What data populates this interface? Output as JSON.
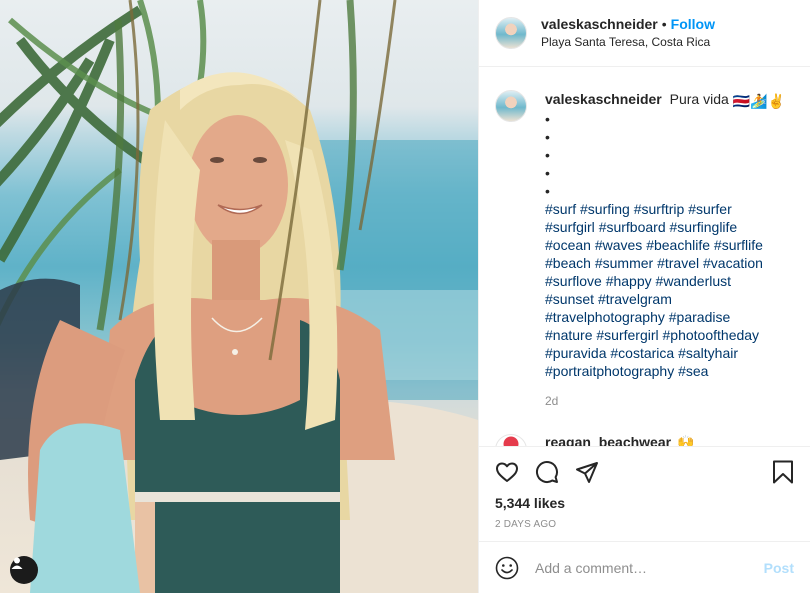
{
  "post": {
    "author": "valeskaschneider",
    "follow_label": "Follow",
    "separator": "•",
    "location": "Playa Santa Teresa, Costa Rica"
  },
  "caption": {
    "username": "valeskaschneider",
    "text": "Pura vida",
    "emoji": "🇨🇷🏄✌️",
    "bullets": [
      "•",
      "•",
      "•",
      "•",
      "•"
    ],
    "hashtag_lines": [
      [
        "#surf",
        "#surfing",
        "#surftrip",
        "#surfer"
      ],
      [
        "#surfgirl",
        "#surfboard",
        "#surfinglife"
      ],
      [
        "#ocean",
        "#waves",
        "#beachlife",
        "#surflife"
      ],
      [
        "#beach",
        "#summer",
        "#travel",
        "#vacation"
      ],
      [
        "#surflove",
        "#happy",
        "#wanderlust"
      ],
      [
        "#sunset",
        "#travelgram"
      ],
      [
        "#travelphotography",
        "#paradise"
      ],
      [
        "#nature",
        "#surfergirl",
        "#photooftheday"
      ],
      [
        "#puravida",
        "#costarica",
        "#saltyhair"
      ],
      [
        "#portraitphotography",
        "#sea"
      ]
    ],
    "age": "2d"
  },
  "next_comment": {
    "username": "reagan_beachwear",
    "emoji": "🙌"
  },
  "footer": {
    "likes": "5,344 likes",
    "time": "2 DAYS AGO",
    "comment_placeholder": "Add a comment…",
    "post_label": "Post"
  },
  "icons": {
    "like": "heart-icon",
    "comment": "comment-bubble-icon",
    "share": "paper-plane-icon",
    "save": "bookmark-icon",
    "emoji": "smiley-icon",
    "tag": "user-tag-icon"
  },
  "colors": {
    "accent": "#0095f6",
    "hashtag": "#00376b",
    "muted": "#8e8e8e",
    "post_disabled": "#b2dffc"
  }
}
